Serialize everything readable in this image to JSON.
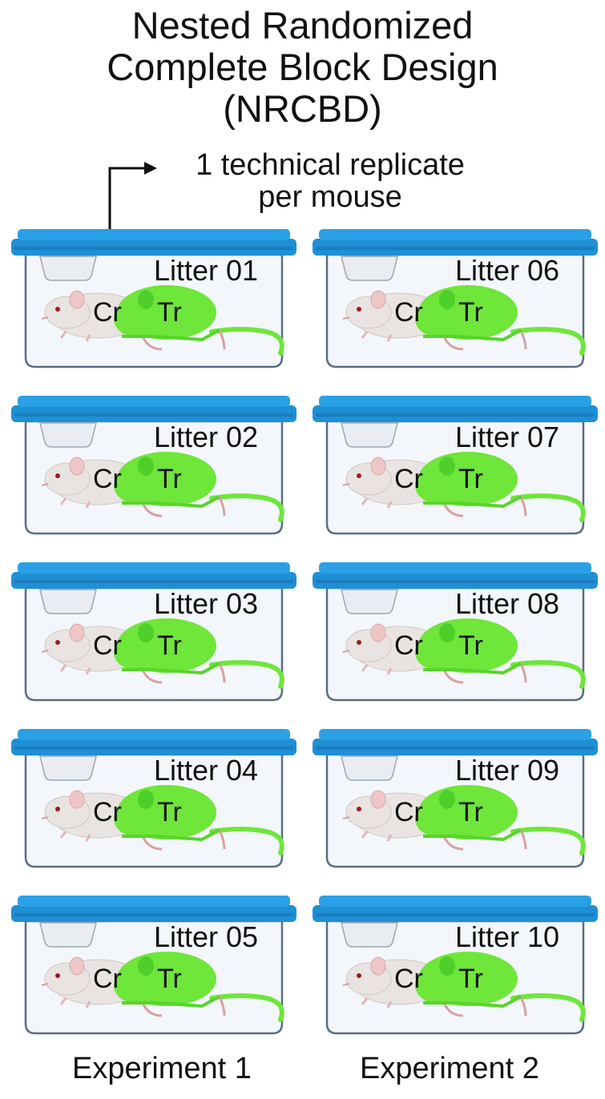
{
  "title_lines": [
    "Nested Randomized",
    "Complete Block Design",
    "(NRCBD)"
  ],
  "annotation_lines": [
    "1 technical replicate",
    "per mouse"
  ],
  "columns": [
    {
      "label": "Experiment 1",
      "litters": [
        "Litter 01",
        "Litter 02",
        "Litter 03",
        "Litter 04",
        "Litter 05"
      ]
    },
    {
      "label": "Experiment 2",
      "litters": [
        "Litter 06",
        "Litter 07",
        "Litter 08",
        "Litter 09",
        "Litter 10"
      ]
    }
  ],
  "mouse_labels": {
    "control": "Cr",
    "treated": "Tr"
  },
  "colors": {
    "lid": "#1f8fd6",
    "cage_outline": "#5a6e86",
    "control_mouse": "#e9e4e1",
    "treated_mouse": "#6ee63a",
    "text": "#111111"
  }
}
